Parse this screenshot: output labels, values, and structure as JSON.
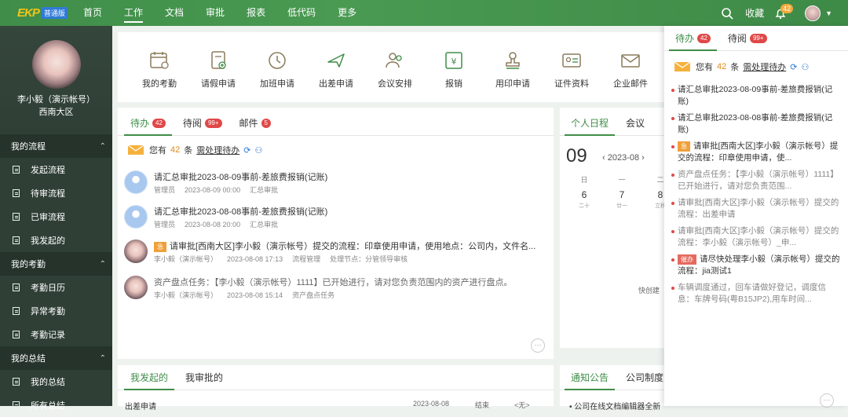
{
  "topbar": {
    "logo": "EKP",
    "logo_tag": "普通版",
    "nav": [
      "首页",
      "工作",
      "文档",
      "审批",
      "报表",
      "低代码",
      "更多"
    ],
    "active": "工作",
    "favorites": "收藏",
    "notify_count": "42"
  },
  "sidebar": {
    "user_name": "李小毅（演示帐号）",
    "dept": "西南大区",
    "groups": [
      {
        "title": "我的流程",
        "items": [
          "发起流程",
          "待审流程",
          "已审流程",
          "我发起的"
        ]
      },
      {
        "title": "我的考勤",
        "items": [
          "考勤日历",
          "异常考勤",
          "考勤记录"
        ]
      },
      {
        "title": "我的总结",
        "items": [
          "我的总结",
          "所有总结"
        ]
      }
    ]
  },
  "apps": [
    "我的考勤",
    "请假申请",
    "加班申请",
    "出差申请",
    "会议安排",
    "报销",
    "用印申请",
    "证件资料",
    "企业邮件"
  ],
  "todo": {
    "tabs": [
      {
        "label": "待办",
        "count": "42"
      },
      {
        "label": "待阅",
        "count": "99+"
      },
      {
        "label": "邮件",
        "count": "5"
      }
    ],
    "summary": {
      "pre": "您有",
      "count": "42",
      "unit": "条",
      "link": "需处理待办"
    },
    "items": [
      {
        "title": "请汇总审批2023-08-09事前-差旅费报销(记账)",
        "role": "管理员",
        "time": "2023-08-09 00:00",
        "cat": "汇总审批",
        "node": ""
      },
      {
        "title": "请汇总审批2023-08-08事前-差旅费报销(记账)",
        "role": "管理员",
        "time": "2023-08-08 20:00",
        "cat": "汇总审批",
        "node": ""
      },
      {
        "tag": "急",
        "title": "请审批[西南大区]李小毅（演示帐号）提交的流程：印章使用申请，使用地点：公司内，文件名...",
        "role": "李小毅（演示帐号）",
        "time": "2023-08-08 17:13",
        "cat": "流程管理",
        "node": "处理节点：分管领导审核"
      },
      {
        "title": "资产盘点任务：【李小毅（演示帐号）1111】已开始进行，请对您负责范围内的资产进行盘点。",
        "role": "李小毅（演示帐号）",
        "time": "2023-08-08 15:14",
        "cat": "资产盘点任务",
        "node": ""
      }
    ]
  },
  "calendar": {
    "tabs": [
      "个人日程",
      "会议"
    ],
    "day": "09",
    "month": "2023-08",
    "weekdays": [
      "日",
      "一",
      "二"
    ],
    "dates": [
      "6",
      "7",
      "8"
    ],
    "lunar": [
      "二十",
      "廿一",
      "立秋"
    ],
    "quick": "快创建"
  },
  "bottom": {
    "tabs": [
      "我发起的",
      "我审批的"
    ],
    "row": {
      "title": "出差申请",
      "date": "2023-08-08",
      "status": "结束",
      "extra": "<无>"
    }
  },
  "notice": {
    "tabs": [
      "通知公告",
      "公司制度"
    ],
    "first": "公司在线文档编辑器全新"
  },
  "drawer": {
    "tabs": [
      {
        "label": "待办",
        "count": "42"
      },
      {
        "label": "待阅",
        "count": "99+"
      }
    ],
    "summary": {
      "pre": "您有",
      "count": "42",
      "unit": "条",
      "link": "需处理待办"
    },
    "items": [
      {
        "text": "请汇总审批2023-08-09事前-差旅费报销(记账)",
        "tag": "",
        "style": "dark"
      },
      {
        "text": "请汇总审批2023-08-08事前-差旅费报销(记账)",
        "tag": "",
        "style": "dark"
      },
      {
        "text": "请审批[西南大区]李小毅（演示帐号）提交的流程：印章使用申请，使...",
        "tag": "急",
        "style": "dark"
      },
      {
        "text": "资产盘点任务：【李小毅（演示帐号）1111】已开始进行，请对您负责范围...",
        "tag": "",
        "style": "grey"
      },
      {
        "text": "请审批[西南大区]李小毅（演示帐号）提交的流程：出差申请",
        "tag": "",
        "style": "grey"
      },
      {
        "text": "请审批[西南大区]李小毅（演示帐号）提交的流程：李小毅（演示帐号）_申...",
        "tag": "",
        "style": "grey"
      },
      {
        "text": "请尽快处理李小毅（演示帐号）提交的流程：jia测试1",
        "tag": "催办",
        "style": "dark"
      },
      {
        "text": "车辆调度通过，回车请做好登记，调度信息：车牌号码(粤B15JP2),用车时间...",
        "tag": "",
        "style": "grey"
      }
    ]
  },
  "colors": {
    "brand": "#3f8d49",
    "sidebar": "#2f3f36",
    "badge": "#e04848",
    "orange": "#f0a03a"
  }
}
